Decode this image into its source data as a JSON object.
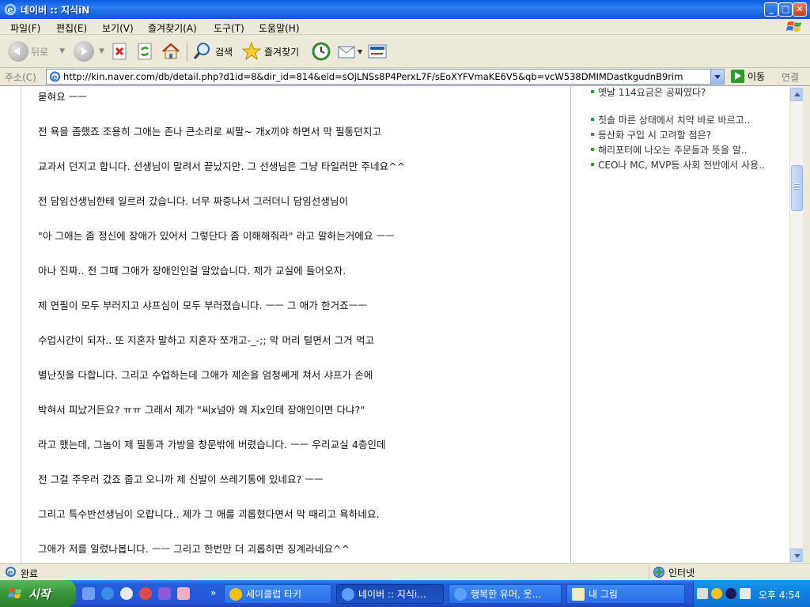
{
  "window": {
    "title": "네이버 :: 지식iN"
  },
  "menu": [
    "파일(F)",
    "편집(E)",
    "보기(V)",
    "즐겨찾기(A)",
    "도구(T)",
    "도움말(H)"
  ],
  "toolbar": {
    "back_label": "뒤로",
    "search_label": "검색",
    "favorites_label": "즐겨찾기"
  },
  "address": {
    "label": "주소(C)",
    "url": "http://kin.naver.com/db/detail.php?d1id=8&dir_id=814&eid=sOjLNSs8P4PerxL7F/sEoXYFVmaKE6V5&qb=vcW538DMIMDastkgudnB9rim",
    "go_label": "이동",
    "links_label": "연결"
  },
  "article": {
    "paragraphs": [
      "묻혀요 ㅡㅡ",
      "전 욕을 좀했죠 조용히 그애는 존나 큰소리로 씨팔~ 개x끼야 하면서 막 필통던지고",
      "교과서 던지고 합니다. 선생님이 말려서 끝났지만. 그 선생님은 그냥 타일러만 주네요^^",
      "전 담임선생님한테 일르러 갔습니다. 너무 짜증나서 그러더니 담임선생님이",
      "\"아 그애는 좀 정신에 장애가 있어서 그렇단다 좀 이해해줘라\" 라고 말하는거에요 ㅡㅡ",
      "아나 진짜.. 전 그때 그애가 장애인인걸 알았습니다. 제가 교실에 들어오자.",
      "제 연필이 모두 부러지고 샤프심이 모두 부러졌습니다. ㅡㅡ 그 애가 한거죠ㅡㅡ",
      "수업시간이 되자.. 또 지혼자 말하고 지혼자 쪼개고-_-;; 막 머리 털면서 그거 먹고",
      "별난짓을 다합니다. 그리고 수업하는데 그애가 제손을 엄청쎄게 쳐서 샤프가 손에",
      "박혀서 피났거든요? ㅠㅠ 그래서 제가 \"씨x넘아 왜 지x인데 장애인이면 다냐?\"",
      "라고 했는데, 그놈이 제 필통과 가방을 창문밖에 버렸습니다. ㅡㅡ 우리교실 4층인데",
      "전 그걸 주우러 갔죠 줍고 오니까 제 신발이 쓰레기통에 있네요? ㅡㅡ",
      "그리고 특수반선생님이 오랍니다.. 제가 그 애를 괴롭혔다면서 막 때리고 욕하네요.",
      "그애가 저를 일렀나봅니다. ㅡㅡ 그리고 한번만 더 괴롭히면 징계라네요^^"
    ]
  },
  "sidebar": {
    "items": [
      "옛날 114요금은 공짜였다?",
      "칫솔 마른 상태에서 치약 바로 바르고..",
      "등산화 구입 시 고려할 점은?",
      "해리포터에 나오는 주문들과 뜻을 알..",
      "CEO나 MC, MVP등 사회 전반에서 사용.."
    ]
  },
  "status": {
    "text": "완료",
    "zone": "인터넷"
  },
  "taskbar": {
    "start_label": "시작",
    "tasks": [
      "세이클럽 타키",
      "네이버 :: 지식i...",
      "행복한 유머, 웃...",
      "내 그림"
    ],
    "clock": "오후 4:54"
  },
  "colors": {
    "titlebar": "#0a5be0",
    "taskbar": "#245edb",
    "start": "#379537",
    "sidebar_bullet": "#2aa52a"
  }
}
